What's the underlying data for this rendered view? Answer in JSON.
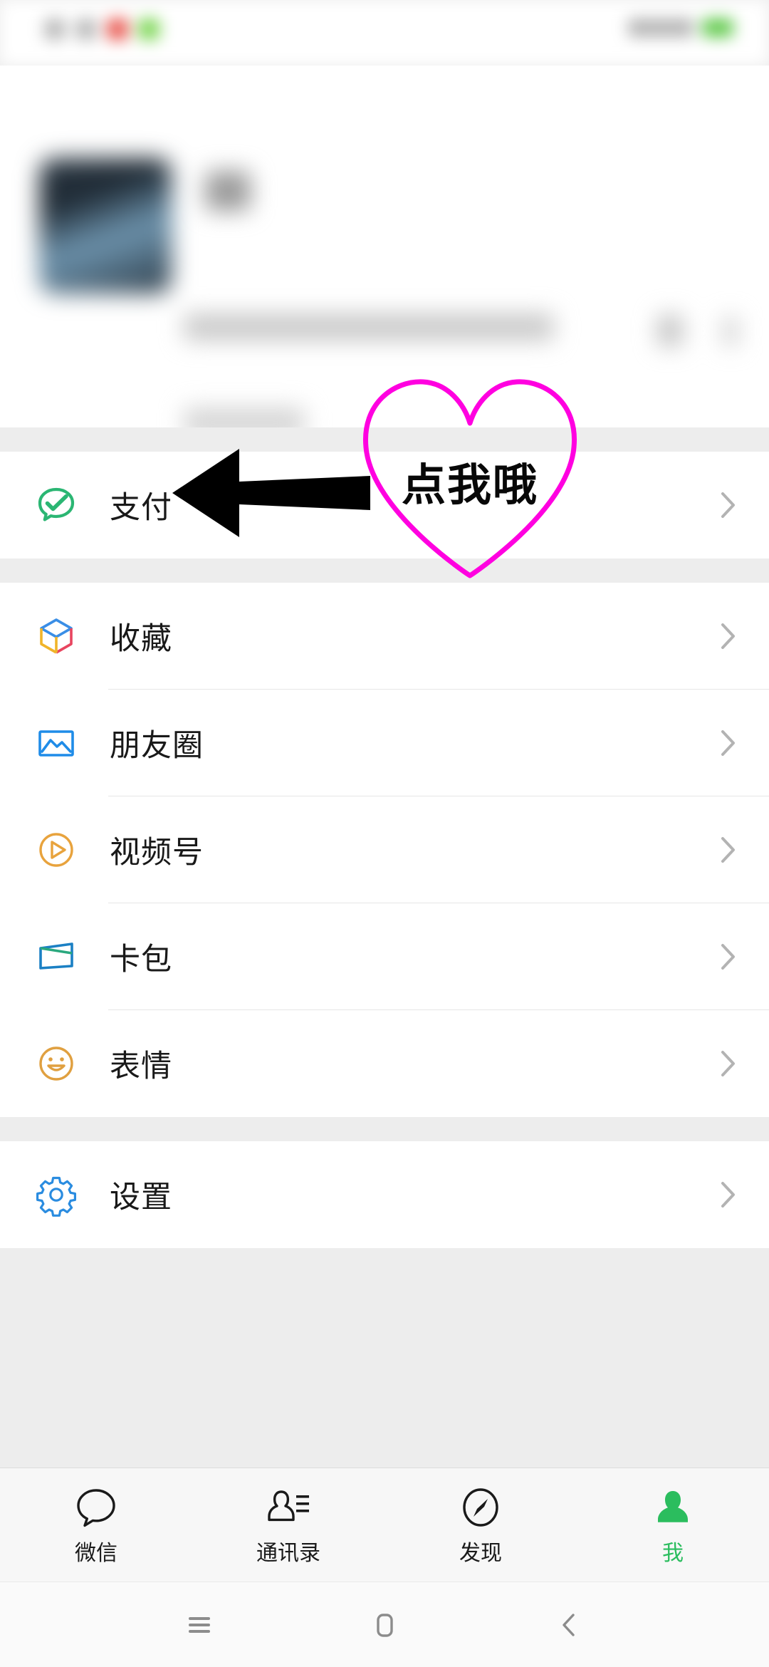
{
  "app": {
    "name": "WeChat",
    "screen_title": "Me",
    "accent_green": "#07c160",
    "tab_active_green": "#2bbd5e",
    "background_gray": "#ededed",
    "card_white": "#ffffff",
    "divider_gray": "#e6e6e6",
    "chevron_gray": "#b3b3b3"
  },
  "status_bar": {
    "blurred": "true",
    "note": "obscured for privacy"
  },
  "profile": {
    "blurred": "true",
    "note": "avatar, nickname, WeChat ID and QR code obscured for privacy",
    "avatar_icon": "avatar-image",
    "qr_icon": "qr-code-icon",
    "chevron_icon": "chevron-right-icon"
  },
  "menu_groups": [
    {
      "group_name": "pay",
      "items": [
        {
          "label": "支付",
          "icon": "pay-bubble-check-icon",
          "icon_color": "#2bb673",
          "chevron": "chevron-right-icon"
        }
      ]
    },
    {
      "group_name": "services",
      "items": [
        {
          "label": "收藏",
          "icon": "favorites-cube-icon",
          "icon_color": "#3a8ee6",
          "chevron": "chevron-right-icon"
        },
        {
          "label": "朋友圈",
          "icon": "moments-photo-icon",
          "icon_color": "#1f8ce8",
          "chevron": "chevron-right-icon"
        },
        {
          "label": "视频号",
          "icon": "channels-play-icon",
          "icon_color": "#e8a33d",
          "chevron": "chevron-right-icon"
        },
        {
          "label": "卡包",
          "icon": "cards-wallet-icon",
          "icon_color": "#1b80c4",
          "chevron": "chevron-right-icon"
        },
        {
          "label": "表情",
          "icon": "stickers-smiley-icon",
          "icon_color": "#e0a040",
          "chevron": "chevron-right-icon"
        }
      ]
    },
    {
      "group_name": "settings",
      "items": [
        {
          "label": "设置",
          "icon": "settings-gear-icon",
          "icon_color": "#2a8ce0",
          "chevron": "chevron-right-icon"
        }
      ]
    }
  ],
  "annotation": {
    "arrow_icon": "left-pointing-arrow",
    "arrow_color": "#000000",
    "heart_icon": "heart-outline",
    "heart_color": "#ff00e0",
    "heart_text": "点我哦",
    "heart_text_color": "#080808"
  },
  "tab_bar": {
    "tabs": [
      {
        "label": "微信",
        "icon": "chat-bubble-icon",
        "active": false
      },
      {
        "label": "通讯录",
        "icon": "contacts-icon",
        "active": false
      },
      {
        "label": "发现",
        "icon": "compass-icon",
        "active": false
      },
      {
        "label": "我",
        "icon": "person-icon",
        "active": true
      }
    ]
  },
  "android_nav": {
    "buttons": [
      {
        "name": "recents-button",
        "icon": "menu-lines-icon"
      },
      {
        "name": "home-button",
        "icon": "rounded-square-icon"
      },
      {
        "name": "back-button",
        "icon": "chevron-left-icon"
      }
    ]
  }
}
